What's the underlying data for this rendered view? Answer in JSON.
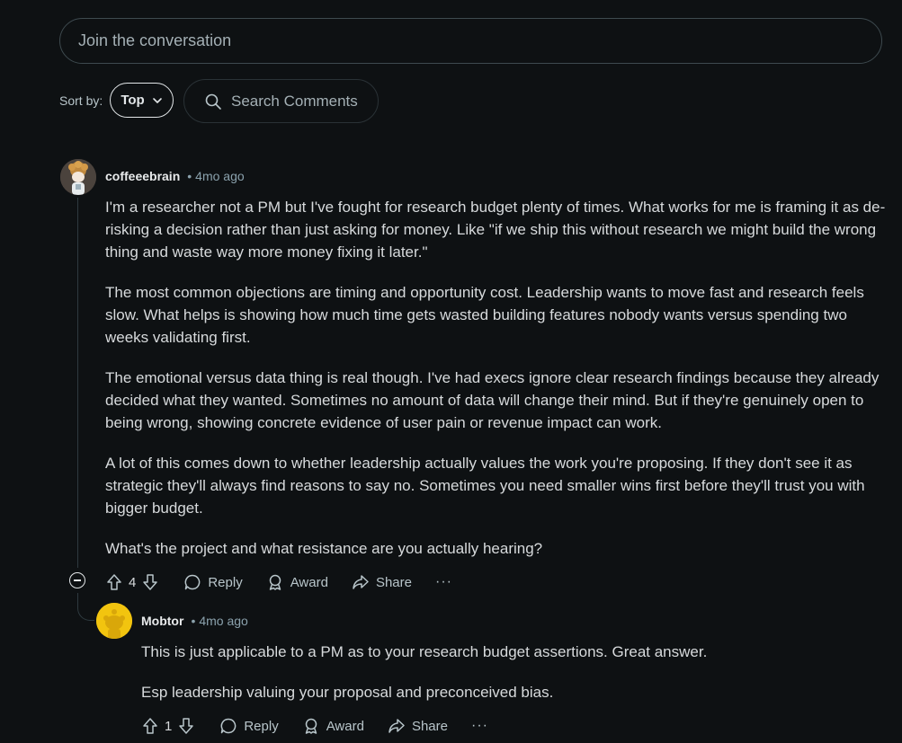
{
  "composer": {
    "placeholder": "Join the conversation"
  },
  "sort": {
    "label": "Sort by:",
    "selected": "Top"
  },
  "search": {
    "label": "Search Comments"
  },
  "comments": [
    {
      "author": "coffeeebrain",
      "separator": "•",
      "time": "4mo ago",
      "paragraphs": [
        "I'm a researcher not a PM but I've fought for research budget plenty of times. What works for me is framing it as de-risking a decision rather than just asking for money. Like \"if we ship this without research we might build the wrong thing and waste way more money fixing it later.\"",
        "The most common objections are timing and opportunity cost. Leadership wants to move fast and research feels slow. What helps is showing how much time gets wasted building features nobody wants versus spending two weeks validating first.",
        "The emotional versus data thing is real though. I've had execs ignore clear research findings because they already decided what they wanted. Sometimes no amount of data will change their mind. But if they're genuinely open to being wrong, showing concrete evidence of user pain or revenue impact can work.",
        "A lot of this comes down to whether leadership actually values the work you're proposing. If they don't see it as strategic they'll always find reasons to say no. Sometimes you need smaller wins first before they'll trust you with bigger budget.",
        "What's the project and what resistance are you actually hearing?"
      ],
      "votes": "4",
      "actions": {
        "reply": "Reply",
        "award": "Award",
        "share": "Share",
        "more": "···"
      }
    },
    {
      "author": "Mobtor",
      "separator": "•",
      "time": "4mo ago",
      "paragraphs": [
        "This is just applicable to a PM as to your research budget assertions. Great answer.",
        "Esp leadership valuing your proposal and preconceived bias."
      ],
      "votes": "1",
      "actions": {
        "reply": "Reply",
        "award": "Award",
        "share": "Share",
        "more": "···"
      }
    }
  ],
  "colors": {
    "background": "#0e1113",
    "text": "#d7dadc",
    "muted": "#8ba2ad",
    "avatar_yellow": "#f2c40f"
  }
}
